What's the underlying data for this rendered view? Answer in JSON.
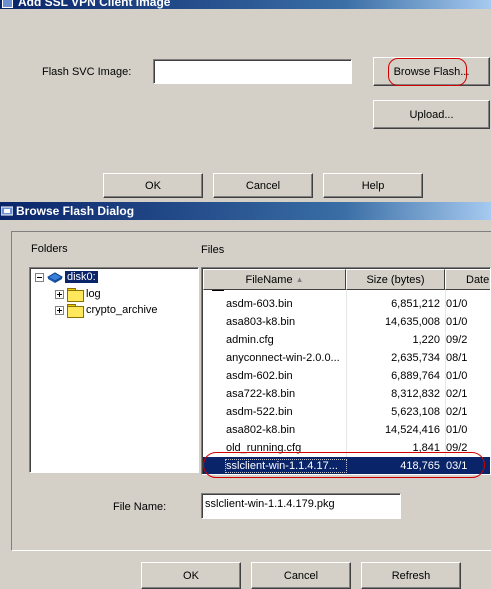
{
  "top_dialog": {
    "title": "Add SSL VPN Client Image",
    "flash_svc_label": "Flash SVC Image:",
    "flash_svc_value": "",
    "browse_flash_label": "Browse Flash...",
    "upload_label": "Upload...",
    "ok_label": "OK",
    "cancel_label": "Cancel",
    "help_label": "Help"
  },
  "browse_dialog": {
    "title": "Browse Flash Dialog",
    "folders_label": "Folders",
    "files_label": "Files",
    "tree": {
      "root": "disk0:",
      "children": [
        "log",
        "crypto_archive"
      ]
    },
    "columns": [
      "FileName",
      "Size (bytes)",
      "Date"
    ],
    "sort_indicator": "▲",
    "rows": [
      {
        "name": "asdm-603.bin",
        "size": "6,851,212",
        "date": "01/0"
      },
      {
        "name": "asa803-k8.bin",
        "size": "14,635,008",
        "date": "01/0"
      },
      {
        "name": "admin.cfg",
        "size": "1,220",
        "date": "09/2"
      },
      {
        "name": "anyconnect-win-2.0.0...",
        "size": "2,635,734",
        "date": "08/1"
      },
      {
        "name": "asdm-602.bin",
        "size": "6,889,764",
        "date": "01/0"
      },
      {
        "name": "asa722-k8.bin",
        "size": "8,312,832",
        "date": "02/1"
      },
      {
        "name": "asdm-522.bin",
        "size": "5,623,108",
        "date": "02/1"
      },
      {
        "name": "asa802-k8.bin",
        "size": "14,524,416",
        "date": "01/0"
      },
      {
        "name": "old_running.cfg",
        "size": "1,841",
        "date": "09/2"
      },
      {
        "name": "sslclient-win-1.1.4.17...",
        "size": "418,765",
        "date": "03/1"
      }
    ],
    "selected_index": 9,
    "file_name_label": "File Name:",
    "file_name_value": "sslclient-win-1.1.4.179.pkg",
    "ok_label": "OK",
    "cancel_label": "Cancel",
    "refresh_label": "Refresh"
  },
  "colors": {
    "dialog_bg": "#d4d0c8",
    "titlebar": "#0a246a",
    "selection": "#0a246a",
    "annotation_oval": "#d00000"
  }
}
